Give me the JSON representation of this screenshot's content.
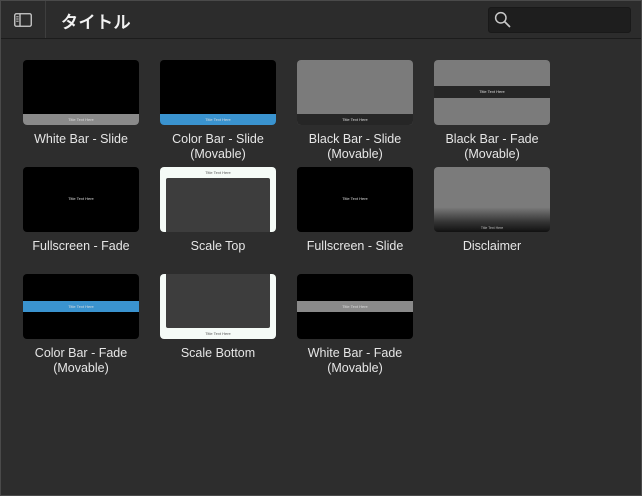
{
  "header": {
    "title": "タイトル",
    "search_placeholder": "",
    "sidebar_toggle_icon": "sidebar-icon",
    "search_icon": "search-icon"
  },
  "colors": {
    "accent_blue": "#3a93cf",
    "bar_gray": "#808080",
    "background": "#2d2d2d"
  },
  "thumb_text": "Title Text Here",
  "titles": [
    {
      "line1": "White Bar - Slide",
      "line2": ""
    },
    {
      "line1": "Color Bar - Slide",
      "line2": "(Movable)"
    },
    {
      "line1": "Black Bar - Slide",
      "line2": "(Movable)"
    },
    {
      "line1": "Black Bar - Fade",
      "line2": "(Movable)"
    },
    {
      "line1": "Fullscreen - Fade",
      "line2": ""
    },
    {
      "line1": "Scale Top",
      "line2": ""
    },
    {
      "line1": "Fullscreen - Slide",
      "line2": ""
    },
    {
      "line1": "Disclaimer",
      "line2": ""
    },
    {
      "line1": "Color Bar - Fade",
      "line2": "(Movable)"
    },
    {
      "line1": "Scale Bottom",
      "line2": ""
    },
    {
      "line1": "White Bar - Fade",
      "line2": "(Movable)"
    }
  ]
}
